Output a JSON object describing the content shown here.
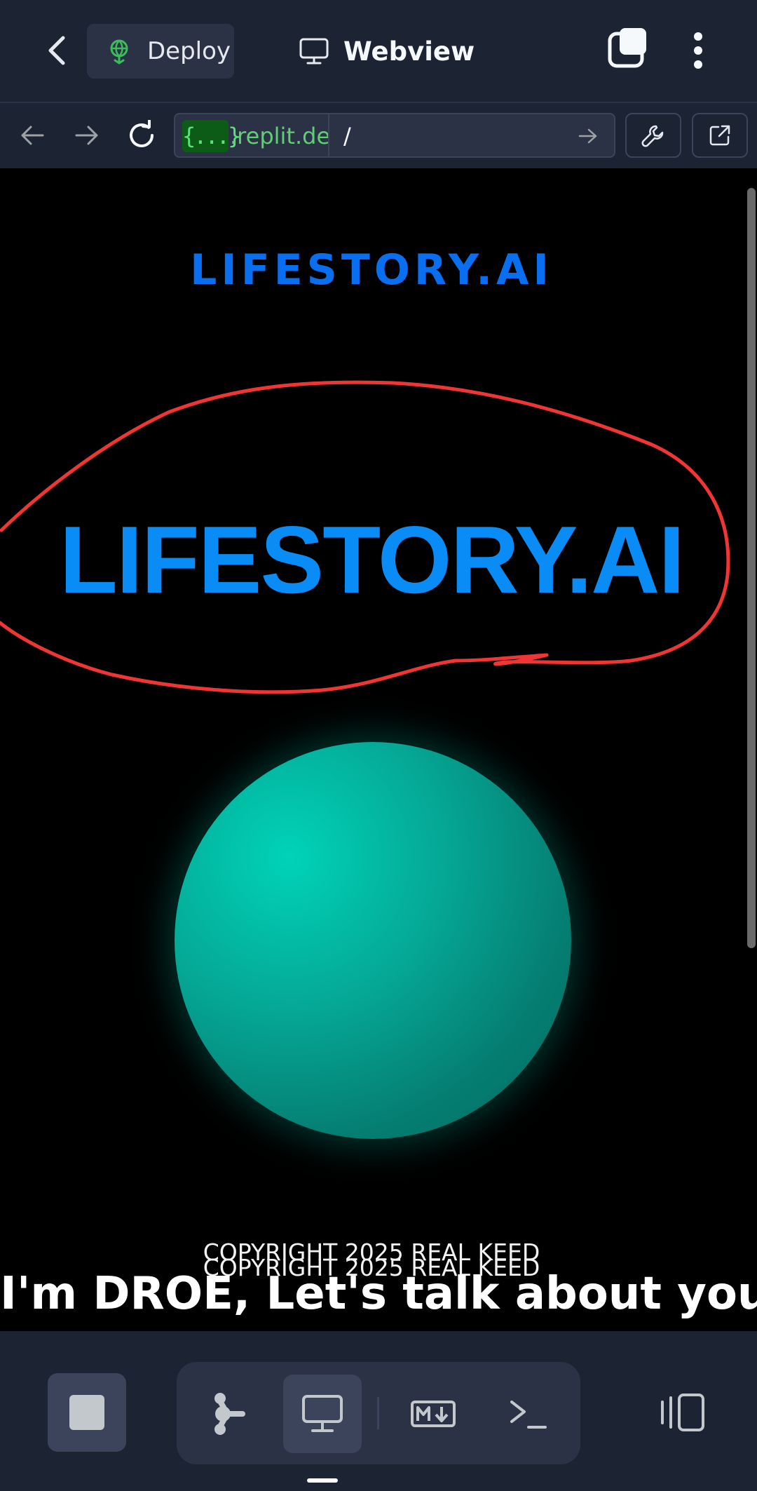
{
  "topbar": {
    "deploy_label": "Deploy",
    "tab_title": "Webview"
  },
  "urlbar": {
    "chip": "{...}",
    "host": ".replit.de",
    "path": "/"
  },
  "webview": {
    "brand_small": "LIFESTORY.AI",
    "brand_big": "LIFESTORY.AI",
    "copyright_1": "COPYRIGHT 2025 REAL KEED",
    "copyright_2": "COPYRIGHT 2025 REAL KEED",
    "tagline": "I'm DROE, Let's talk about your"
  },
  "colors": {
    "app_bar": "#1c2333",
    "brand_blue": "#0a8cf7",
    "scribble_red": "#f03535",
    "orb_teal": "#05a896"
  },
  "icons": {
    "deploy": "rocket-globe-icon",
    "webview": "monitor-icon",
    "agent": "agent-nodes-icon",
    "markdown": "markdown-icon",
    "shell": "terminal-icon",
    "layout": "layout-panels-icon"
  }
}
